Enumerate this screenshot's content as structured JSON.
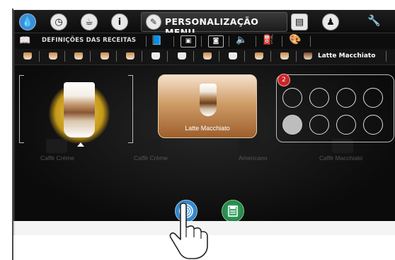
{
  "topbar": {
    "title": "PERSONALIZAÇÃO MENU",
    "icons": [
      "drop-icon",
      "clock-icon",
      "cup-icon",
      "info-icon",
      "pen-icon",
      "calc-icon",
      "person-icon",
      "wrench-icon"
    ]
  },
  "recipes_bar": {
    "label": "DEFINIÇÕES DAS RECEITAS"
  },
  "drink_strip": {
    "selected_label": "Latte Macchiato"
  },
  "main": {
    "card_label": "Latte Macchiato",
    "slot_count_badge": "2",
    "ghost_labels": [
      "Caffè Crème",
      "Caffè Crème",
      "Americano",
      "Caffè Macchiato"
    ]
  },
  "colors": {
    "accent_blue": "#3a8fd8",
    "gold": "#e2b830",
    "save_green": "#2f9a5a",
    "badge_red": "#c9262b"
  }
}
